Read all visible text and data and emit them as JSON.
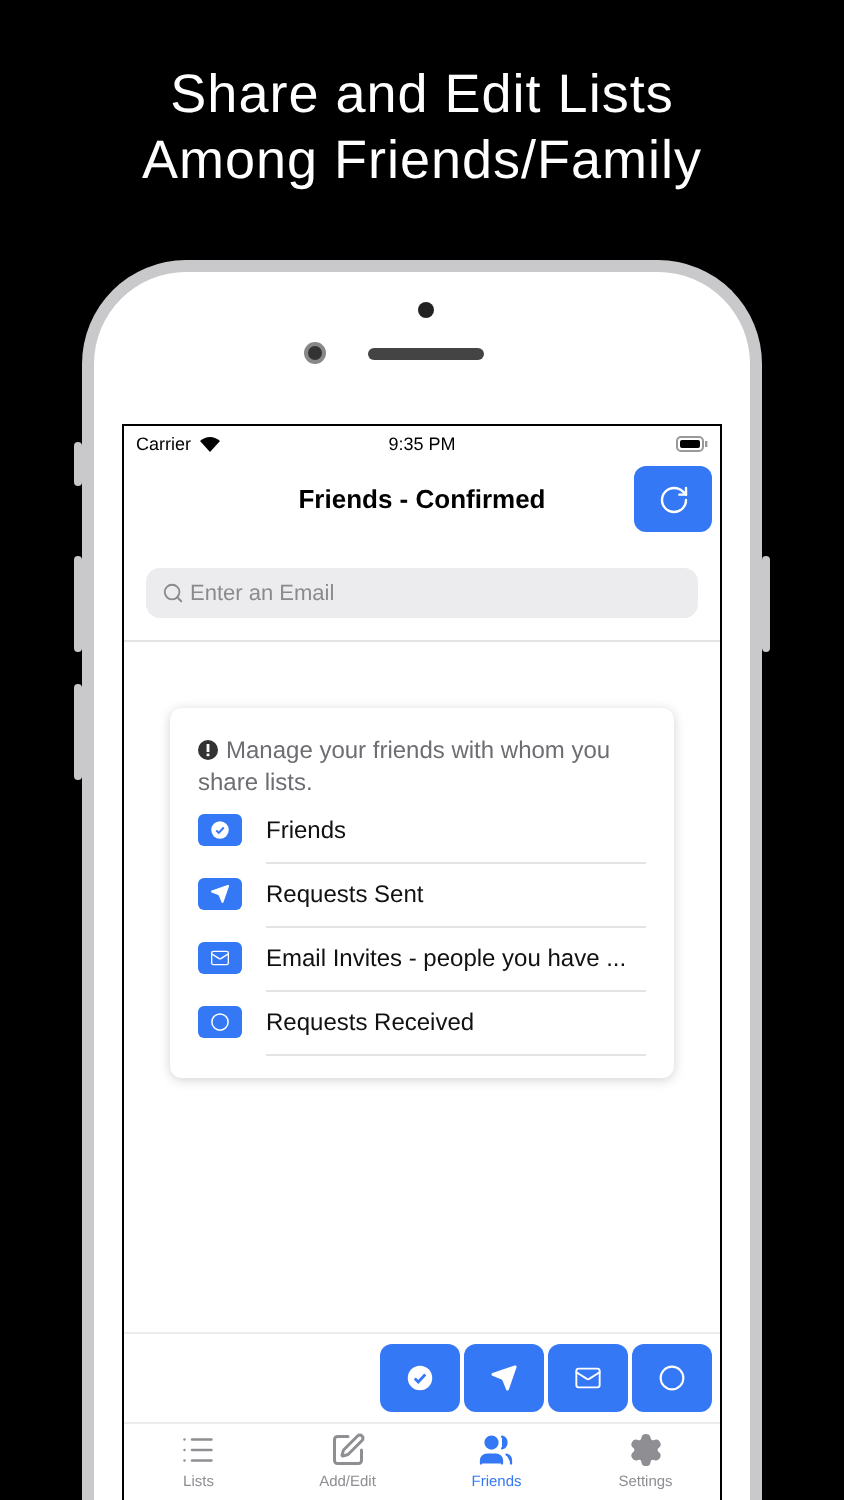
{
  "headline": [
    "Share and Edit Lists",
    "Among Friends/Family"
  ],
  "status_bar": {
    "carrier": "Carrier",
    "time": "9:35 PM"
  },
  "nav": {
    "title": "Friends - Confirmed"
  },
  "search": {
    "placeholder": "Enter an Email"
  },
  "info_card": {
    "note": "Manage your friends with whom you share lists.",
    "items": [
      {
        "kind": "check",
        "label": "Friends"
      },
      {
        "kind": "plane",
        "label": "Requests Sent"
      },
      {
        "kind": "mail",
        "label": "Email Invites - people you have ..."
      },
      {
        "kind": "circle",
        "label": "Requests Received"
      }
    ]
  },
  "filter_buttons": [
    {
      "kind": "check"
    },
    {
      "kind": "plane"
    },
    {
      "kind": "mail"
    },
    {
      "kind": "circle"
    }
  ],
  "tabs": [
    {
      "kind": "list",
      "label": "Lists",
      "selected": false
    },
    {
      "kind": "edit",
      "label": "Add/Edit",
      "selected": false
    },
    {
      "kind": "people",
      "label": "Friends",
      "selected": true
    },
    {
      "kind": "gear",
      "label": "Settings",
      "selected": false
    }
  ]
}
